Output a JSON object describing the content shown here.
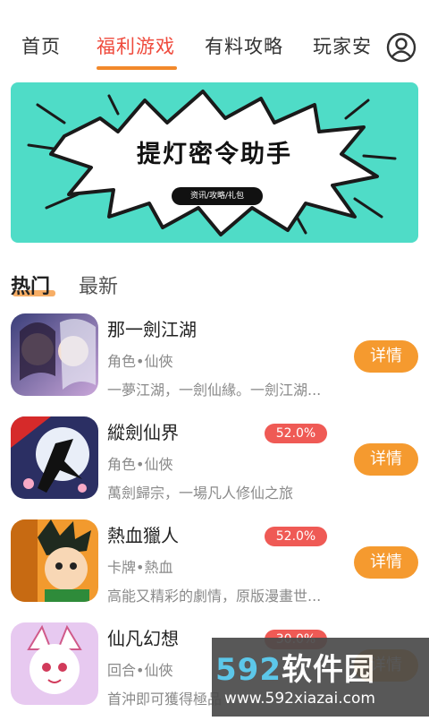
{
  "nav": {
    "tabs": [
      {
        "label": "首页"
      },
      {
        "label": "福利游戏"
      },
      {
        "label": "有料攻略"
      },
      {
        "label": "玩家安"
      }
    ],
    "active_tab": "福利游戏",
    "profile_icon": "user-circle-icon"
  },
  "banner": {
    "title": "提灯密令助手",
    "pill": "资讯/攻略/礼包",
    "background_color": "#4fdcc7"
  },
  "subtabs": {
    "hot": "热门",
    "new": "最新"
  },
  "games": [
    {
      "name": "那一劍江湖",
      "category": "角色•仙俠",
      "desc": "一夢江湖，一劍仙緣。一劍江湖...",
      "badge": "",
      "action": "详情"
    },
    {
      "name": "縱劍仙界",
      "category": "角色•仙俠",
      "desc": "萬劍歸宗，一場凡人修仙之旅",
      "badge": "52.0%",
      "action": "详情"
    },
    {
      "name": "熱血獵人",
      "category": "卡牌•熱血",
      "desc": "高能又精彩的劇情，原版漫畫世...",
      "badge": "52.0%",
      "action": "详情"
    },
    {
      "name": "仙凡幻想",
      "category": "回合•仙俠",
      "desc": "首沖即可獲得極品",
      "badge": "30.0%",
      "action": "详情"
    }
  ],
  "watermark": {
    "logo_num": "592",
    "logo_text": "软件园",
    "url": "www.592xiazai.com"
  },
  "colors": {
    "accent_red": "#ef4a3c",
    "accent_orange": "#f59a2f",
    "badge_red": "#ef5a55"
  }
}
